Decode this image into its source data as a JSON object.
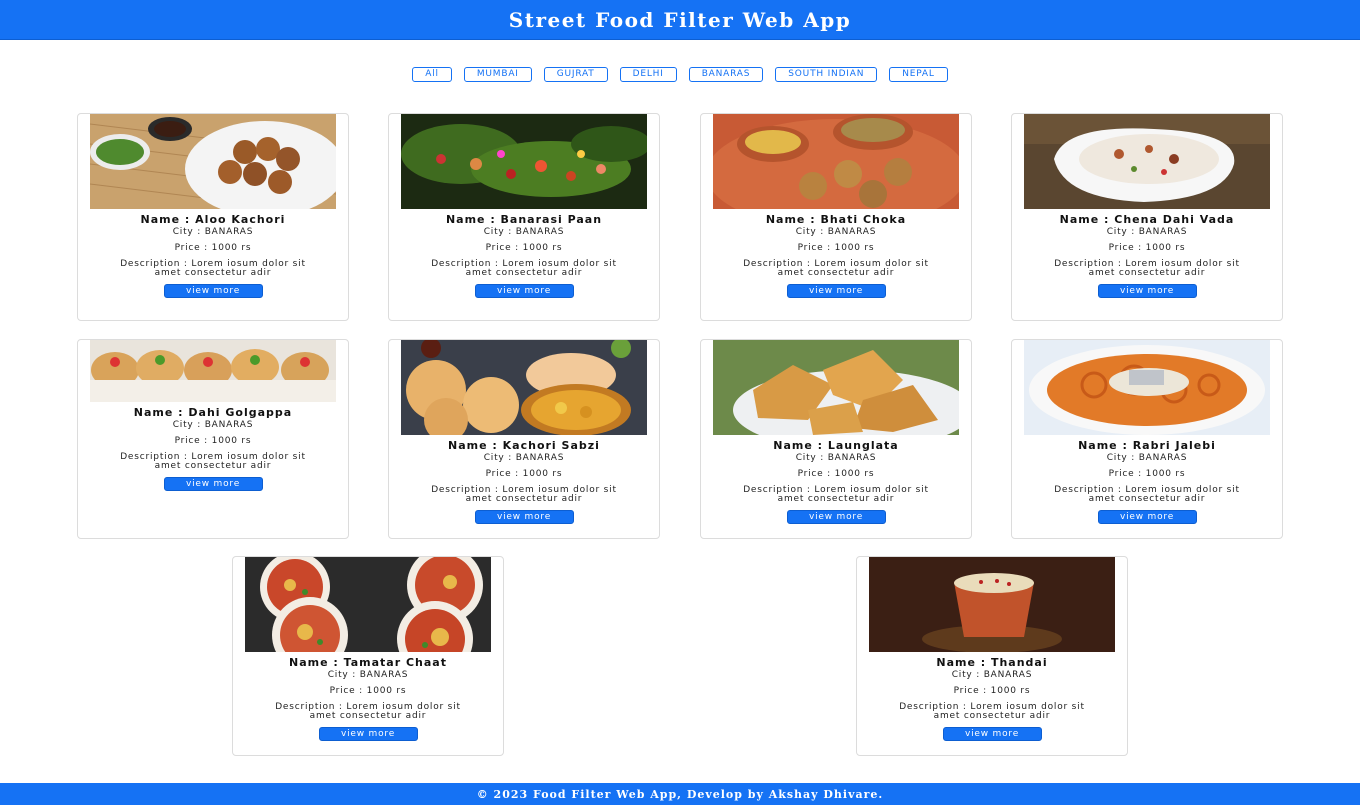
{
  "header": {
    "title": "Street Food Filter Web App"
  },
  "filters": [
    "All",
    "MUMBAI",
    "GUJRAT",
    "DELHI",
    "BANARAS",
    "SOUTH INDIAN",
    "NEPAL"
  ],
  "cards": [
    {
      "name": "Name : Aloo Kachori",
      "city": "City : BANARAS",
      "price": "Price : 1000 rs",
      "desc": "Description : Lorem iosum dolor sit amet consectetur adir",
      "button": "view more"
    },
    {
      "name": "Name : Banarasi Paan",
      "city": "City : BANARAS",
      "price": "Price : 1000 rs",
      "desc": "Description : Lorem iosum dolor sit amet consectetur adir",
      "button": "view more"
    },
    {
      "name": "Name : Bhati Choka",
      "city": "City : BANARAS",
      "price": "Price : 1000 rs",
      "desc": "Description : Lorem iosum dolor sit amet consectetur adir",
      "button": "view more"
    },
    {
      "name": "Name : Chena Dahi Vada",
      "city": "City : BANARAS",
      "price": "Price : 1000 rs",
      "desc": "Description : Lorem iosum dolor sit amet consectetur adir",
      "button": "view more"
    },
    {
      "name": "Name : Dahi Golgappa",
      "city": "City : BANARAS",
      "price": "Price : 1000 rs",
      "desc": "Description : Lorem iosum dolor sit amet consectetur adir",
      "button": "view more"
    },
    {
      "name": "Name : Kachori Sabzi",
      "city": "City : BANARAS",
      "price": "Price : 1000 rs",
      "desc": "Description : Lorem iosum dolor sit amet consectetur adir",
      "button": "view more"
    },
    {
      "name": "Name : Launglata",
      "city": "City : BANARAS",
      "price": "Price : 1000 rs",
      "desc": "Description : Lorem iosum dolor sit amet consectetur adir",
      "button": "view more"
    },
    {
      "name": "Name : Rabri Jalebi",
      "city": "City : BANARAS",
      "price": "Price : 1000 rs",
      "desc": "Description : Lorem iosum dolor sit amet consectetur adir",
      "button": "view more"
    },
    {
      "name": "Name : Tamatar Chaat",
      "city": "City : BANARAS",
      "price": "Price : 1000 rs",
      "desc": "Description : Lorem iosum dolor sit amet consectetur adir",
      "button": "view more"
    },
    {
      "name": "Name : Thandai",
      "city": "City : BANARAS",
      "price": "Price : 1000 rs",
      "desc": "Description : Lorem iosum dolor sit amet consectetur adir",
      "button": "view more"
    }
  ],
  "footer": {
    "text": "© 2023 Food Filter Web App, Develop by Akshay Dhivare."
  },
  "colors": {
    "primary": "#1572f4",
    "card_border": "#dcdcdc"
  }
}
